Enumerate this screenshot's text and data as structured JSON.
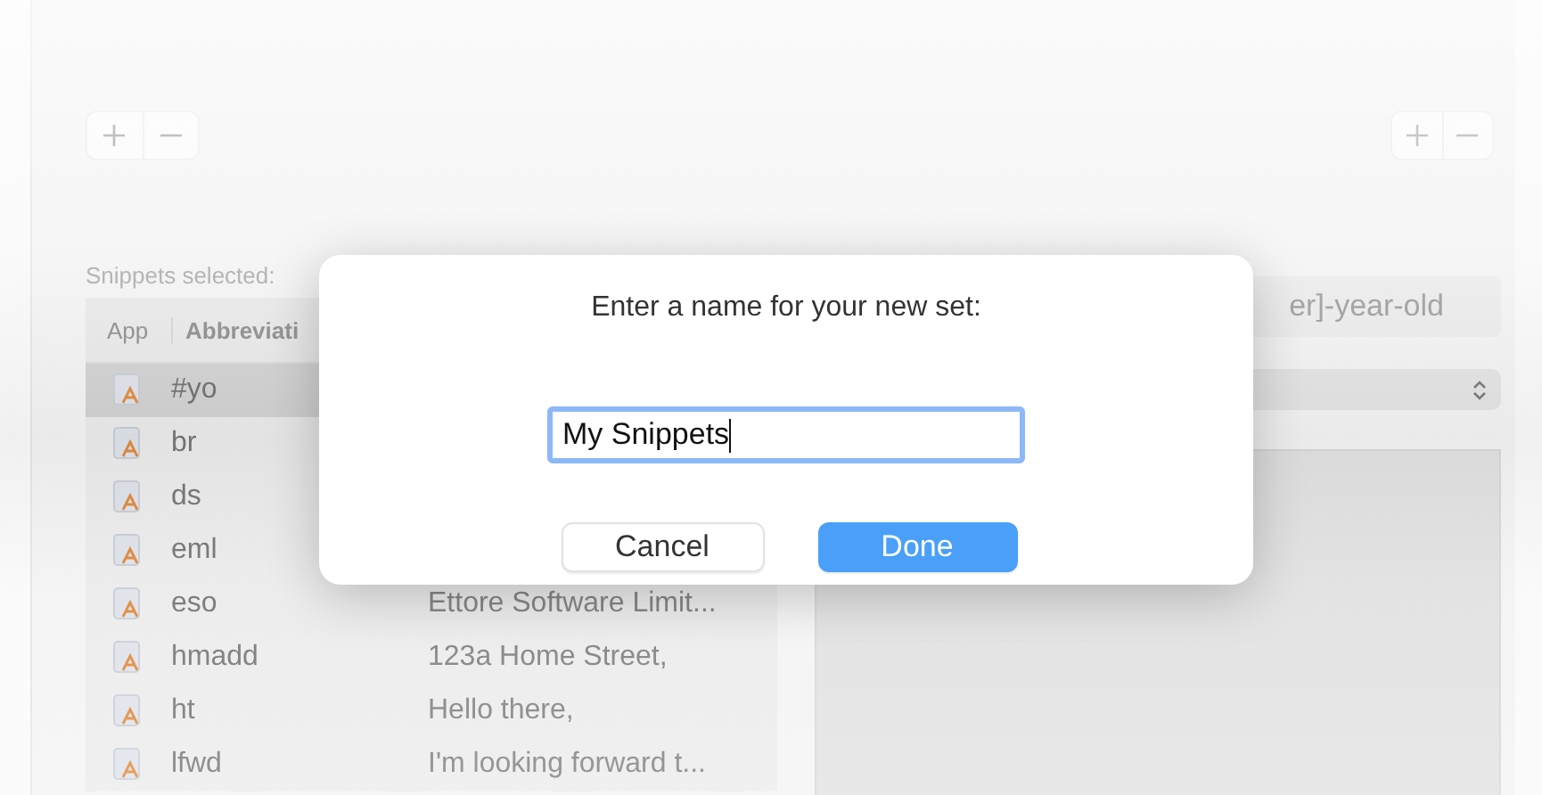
{
  "snippets_panel": {
    "selection_label": "Snippets selected:",
    "columns": [
      "App",
      "Abbreviati"
    ],
    "rows": [
      {
        "abbreviation": "#yo",
        "content": "",
        "selected": true
      },
      {
        "abbreviation": "br",
        "content": "",
        "selected": false
      },
      {
        "abbreviation": "ds",
        "content": "",
        "selected": false
      },
      {
        "abbreviation": "eml",
        "content": "",
        "selected": false
      },
      {
        "abbreviation": "eso",
        "content": "Ettore Software Limit...",
        "selected": false
      },
      {
        "abbreviation": "hmadd",
        "content": "123a Home Street,",
        "selected": false
      },
      {
        "abbreviation": "ht",
        "content": "Hello there,",
        "selected": false
      },
      {
        "abbreviation": "lfwd",
        "content": "I'm looking forward t...",
        "selected": false
      }
    ]
  },
  "detail_panel": {
    "abbreviation_field": {
      "value": "er]-year-old"
    }
  },
  "dialog": {
    "title": "Enter a name for your new set:",
    "name_field": {
      "value": "My Snippets"
    },
    "buttons": [
      {
        "label": "Cancel",
        "kind": "secondary"
      },
      {
        "label": "Done",
        "kind": "primary"
      }
    ]
  }
}
